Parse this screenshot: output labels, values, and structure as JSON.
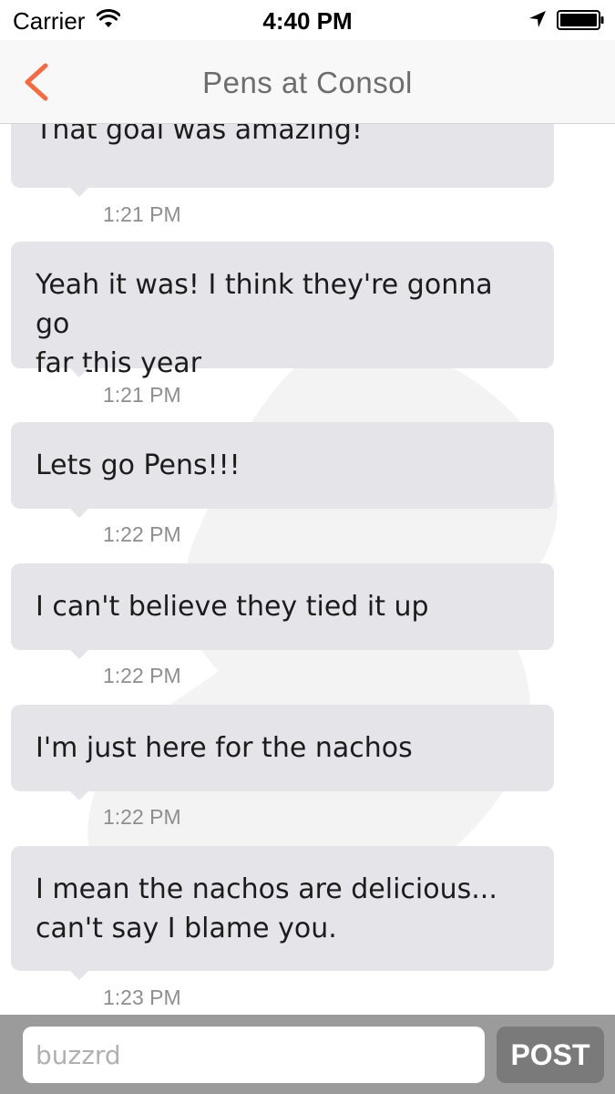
{
  "status_bar": {
    "carrier": "Carrier",
    "time": "4:40 PM"
  },
  "nav": {
    "title": "Pens at Consol"
  },
  "messages": [
    {
      "lines": [
        "That goal was amazing!"
      ],
      "time": "1:21 PM"
    },
    {
      "lines": [
        "Yeah it was!  I think they're gonna go",
        "far this year"
      ],
      "time": "1:21 PM"
    },
    {
      "lines": [
        "Lets go Pens!!!"
      ],
      "time": "1:22 PM"
    },
    {
      "lines": [
        "I can't believe they tied it up"
      ],
      "time": "1:22 PM"
    },
    {
      "lines": [
        "I'm just here for the nachos"
      ],
      "time": "1:22 PM"
    },
    {
      "lines": [
        "I mean the nachos are delicious...",
        "can't say I blame you."
      ],
      "time": "1:23 PM"
    }
  ],
  "composer": {
    "placeholder": "buzzrd",
    "post_label": "POST"
  },
  "colors": {
    "accent": "#f26b45",
    "bubble": "#e5e5e9",
    "input_bar": "#9b9b9b",
    "post_button": "#7a7a7a"
  }
}
